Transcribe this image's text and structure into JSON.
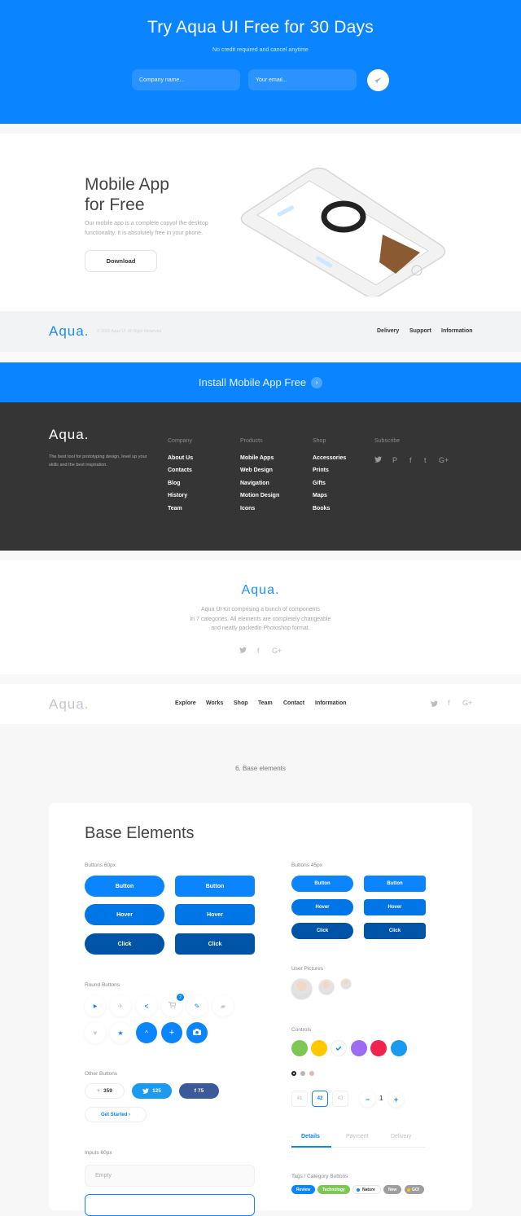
{
  "hero": {
    "title": "Try Aqua UI Free for 30 Days",
    "subtitle": "No credit required and cancel anytime",
    "company_placeholder": "Company name...",
    "email_placeholder": "Your email...",
    "send_icon": "rocket-icon"
  },
  "mobile_app": {
    "title_line1": "Mobile App",
    "title_line2": "for Free",
    "description": "Our mobile app is a complete copyof the desktop functionality. It is absolutely free in your phone.",
    "download_label": "Download"
  },
  "light_footer": {
    "logo": "Aqua.",
    "copyright": "© 2016 Aqua UI. All Right Reserved",
    "links": [
      "Delivery",
      "Support",
      "Information"
    ]
  },
  "install_banner": {
    "label": "Install Mobile App Free",
    "arrow": "›"
  },
  "dark_footer": {
    "logo": "Aqua.",
    "description": "The best tool for prototyping design, level up your skills and the best inspiration.",
    "columns": [
      {
        "heading": "Company",
        "items": [
          "About Us",
          "Contacts",
          "Blog",
          "History",
          "Team"
        ]
      },
      {
        "heading": "Products",
        "items": [
          "Mobile Apps",
          "Web Design",
          "Navigation",
          "Motion Design",
          "Icons"
        ]
      },
      {
        "heading": "Shop",
        "items": [
          "Accessories",
          "Prints",
          "Gifts",
          "Maps",
          "Books"
        ]
      }
    ],
    "subscribe_heading": "Subscribe",
    "social": [
      "twitter-icon",
      "pinterest-icon",
      "facebook-icon",
      "tumblr-icon",
      "google-plus-icon"
    ],
    "social_glyphs": [
      "🐦",
      "P",
      "f",
      "t",
      "G+"
    ]
  },
  "about": {
    "logo": "Aqua.",
    "line1": "Aqua UI Kit comprising a bunch of components",
    "line2": "in 7 categories. All elements are completely changeable",
    "line3": "and neatly packedin Photoshop format.",
    "social_glyphs": [
      "🐦",
      "f",
      "G+"
    ]
  },
  "nav": {
    "logo": "Aqua.",
    "links": [
      "Explore",
      "Works",
      "Shop",
      "Team",
      "Contact",
      "Information"
    ],
    "social_glyphs": [
      "🐦",
      "f",
      "G+"
    ]
  },
  "section_label": "6. Base elements",
  "base": {
    "title": "Base Elements",
    "buttons60_label": "Buttons 60px",
    "buttons45_label": "Buttons 45px",
    "states": [
      "Button",
      "Hover",
      "Click"
    ],
    "round_label": "Round Buttons",
    "round_glyphs": [
      "▶",
      "✈",
      "<",
      "🛒",
      "✎",
      "▰",
      "♥",
      "★",
      "^",
      "+",
      "◉"
    ],
    "cart_badge": "2",
    "other_label": "Other Buttons",
    "like_count": "359",
    "tweet_count": "125",
    "fb_count": "75",
    "get_started": "Get Started ›",
    "inputs_label": "Inputs 60px",
    "input_empty": "Empty",
    "user_pictures_label": "User Pictures",
    "controls_label": "Controls",
    "colors": {
      "green": "#7dc855",
      "yellow": "#ffc800",
      "purple": "#9b6cf2",
      "red": "#f0234f",
      "blue": "#1a9bf0",
      "primary": "#0a84ff",
      "hover": "#0075e6",
      "click": "#0054a8"
    },
    "pagination": [
      "41",
      "42",
      "43"
    ],
    "stepper_value": "1",
    "tabs": [
      "Details",
      "Payment",
      "Delivery"
    ],
    "tags_label": "Tags / Category Buttons",
    "tags": [
      "Review",
      "Technology",
      "Nature",
      "New",
      "GO!"
    ]
  }
}
